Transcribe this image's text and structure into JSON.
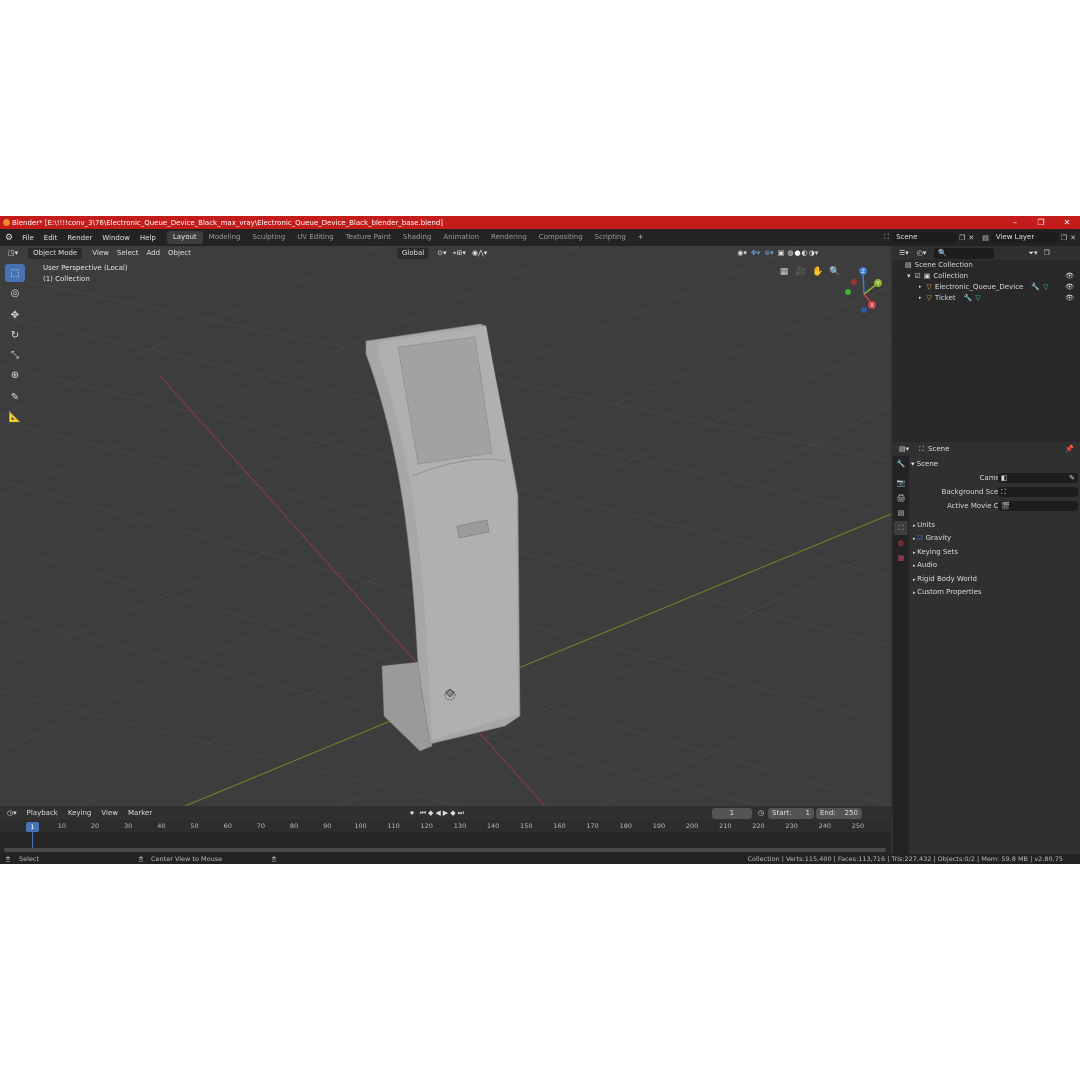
{
  "window": {
    "title": "Blender* [E:\\!!!!conv_3\\76\\Electronic_Queue_Device_Black_max_vray\\Electronic_Queue_Device_Black_blender_base.blend]",
    "min": "–",
    "max": "❐",
    "close": "✕"
  },
  "menu": [
    "File",
    "Edit",
    "Render",
    "Window",
    "Help"
  ],
  "workspaces": [
    "Layout",
    "Modeling",
    "Sculpting",
    "UV Editing",
    "Texture Paint",
    "Shading",
    "Animation",
    "Rendering",
    "Compositing",
    "Scripting"
  ],
  "scene": {
    "name": "Scene",
    "view_layer": "View Layer"
  },
  "viewport": {
    "mode": "Object Mode",
    "header_menu": [
      "View",
      "Select",
      "Add",
      "Object"
    ],
    "orientation": "Global",
    "perspective_label": "User Perspective (Local)",
    "collection_label": "(1) Collection",
    "gizmo": {
      "z": "Z",
      "y": "Y",
      "x": "X"
    },
    "colors": {
      "x_axis": "#c9424a",
      "y_axis": "#8bb32a",
      "z_axis": "#3a7cd6",
      "background": "#3d3d3d"
    }
  },
  "outliner": {
    "root": "Scene Collection",
    "collection": "Collection",
    "items": [
      "Electronic_Queue_Device",
      "Ticket"
    ]
  },
  "properties": {
    "context": "Scene",
    "panel": "Scene",
    "fields": [
      {
        "label": "Camera"
      },
      {
        "label": "Background Scene"
      },
      {
        "label": "Active Movie Clip"
      }
    ],
    "sections": [
      "Units",
      "Gravity",
      "Keying Sets",
      "Audio",
      "Rigid Body World",
      "Custom Properties"
    ]
  },
  "timeline": {
    "menu": [
      "Playback",
      "Keying",
      "View",
      "Marker"
    ],
    "current_frame": "1",
    "start_label": "Start:",
    "start": "1",
    "end_label": "End:",
    "end": "250",
    "ticks": [
      "1",
      "10",
      "20",
      "30",
      "40",
      "50",
      "60",
      "70",
      "80",
      "90",
      "100",
      "110",
      "120",
      "130",
      "140",
      "150",
      "160",
      "170",
      "180",
      "190",
      "200",
      "210",
      "220",
      "230",
      "240",
      "250"
    ]
  },
  "status": {
    "select": "Select",
    "center": "Center View to Mouse",
    "stats": "Collection | Verts:115,400 | Faces:113,716 | Tris:227,432 | Objects:0/2 | Mem: 59.8 MB | v2.80.75"
  }
}
